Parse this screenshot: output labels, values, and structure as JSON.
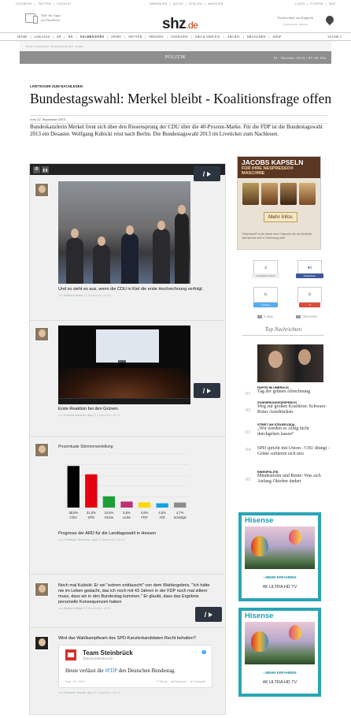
{
  "topbar": {
    "left": [
      "FACEBOOK",
      "TWITTER",
      "GOOGLE+"
    ],
    "mid": [
      "IMMOBILIEN",
      "AUTOS",
      "STELLEN",
      "ANZEIGEN"
    ],
    "right": [
      "LOGIN",
      "E-PAPER",
      "ABO"
    ]
  },
  "masthead": {
    "app_text_1": "Alle shz Apps",
    "app_text_2": "im Überblick",
    "logo_main": "shz",
    "logo_suffix": ".de",
    "region_text": "Nachrichten aus Kappeln",
    "region_sub": "(Schleiboten | ändern)"
  },
  "nav": {
    "items": [
      "HOME",
      "LOKALES",
      "SH",
      "HH",
      "NACHRICHTEN",
      "SPORT",
      "WETTER",
      "FREIZEIT",
      "ANZEIGEN",
      "ABO & SERVICE",
      "ARCHIV",
      "BRANCHEN",
      "SHOP"
    ],
    "search_label": "SUCHE"
  },
  "breadcrumb": "Home › Nachrichten › Deutschland & Welt › Politik",
  "section": {
    "title": "POLITIK",
    "date": "01. Oktober 2013 | 07:36 Uhr"
  },
  "article": {
    "kicker": "LIVETICKER ZUM NACHLESEN",
    "headline": "Bundestagswahl: Merkel bleibt - Koalitionsfrage offen",
    "byline": "vom 22. September 2013",
    "lead": "Bundeskanzlerin Merkel freut sich über den Riesensprung der CDU über die 40-Prozent-Marke. Für die FDP ist die Bundestagswahl 2013 ein Desaster. Wolfgang Kubicki reist nach Berlin. Die Bundestagswahl 2013 im Liveticker zum Nachlesen."
  },
  "ticker": {
    "gear_glyph": "⚙",
    "pause_glyph": "❚❚",
    "video_glyph": "/",
    "posts": [
      {
        "text": "Und so sieht es aus, wenn die CDU in Kiel die erste Hochrechnung verfolgt.",
        "meta_prefix": "von",
        "author": "Barbara Maas",
        "date": "22 September 18:08"
      },
      {
        "text": "Erste Reaktion bei den Grünen.",
        "meta_prefix": "von",
        "author": "Kristina Wiesner, dpa",
        "date": "22 September 18:09"
      },
      {
        "text": "Prognose der ARD für die Landtagswahl in Hessen",
        "meta_prefix": "von",
        "author": "Christoph Dietmann, dpa",
        "date": "22 September 18:18"
      },
      {
        "text": "Noch mal Kubicki: Er sei \"extrem enttäuscht\" von dem Wahlergebnis. \"Ich hätte nie im Leben gedacht, das ich noch mit 43 Jahren in der FDP noch mal zittern muss, dass wir in den Bundestag kommen.\" Er glaubt, dass das Ergebnis personelle Konsequenzen haben",
        "meta_prefix": "von",
        "author": "Barbara Maas",
        "date": "22 September 18:19"
      },
      {
        "text": "Wird das Wahlkampfteam des SPD-Kanzlerkandidaten Recht behalten?",
        "meta_prefix": "von",
        "author": "Henryser Schott, dpa",
        "date": "22 September 18:19"
      }
    ],
    "tweet": {
      "name": "Team Steinbrück",
      "handle": "@teamSteinbrueck",
      "text_before": "Heute verlässt die ",
      "hashtag": "#FDP",
      "text_after": " den Deutschen Bundestag.",
      "date": "Sep. 22, 2013",
      "reply": "Reply",
      "retweet": "Retweet",
      "favorite": "Favorite"
    }
  },
  "chart_data": {
    "type": "bar",
    "title": "Prozentuale Stimmenverteilung",
    "categories": [
      "CDU",
      "SPD",
      "Grüne",
      "Linke",
      "FDP",
      "AfD",
      "Sonstige"
    ],
    "value_labels": [
      "38,8%",
      "31,0%",
      "10,5%",
      "5,6%",
      "4,8%",
      "4,0%",
      "4,7%"
    ],
    "values": [
      38.8,
      31.0,
      10.5,
      5.6,
      4.8,
      4.0,
      4.7
    ],
    "colors": [
      "#000000",
      "#e3000f",
      "#1aa037",
      "#be3075",
      "#ffd600",
      "#13a3e0",
      "#8c8c8c"
    ],
    "ylim": [
      0,
      50
    ],
    "grid": true
  },
  "sidebar": {
    "ad_jacobs": {
      "title": "JACOBS KAPSELN",
      "subtitle": "FÜR IHRE NESPRESSO® MASCHINE",
      "cta": "Mehr Infos",
      "fine_print": "*Nespresso® ist die Marke einer Drittpartei, die mit Mondelēz International nicht in Verbindung steht."
    },
    "shares": {
      "comments_count": "4",
      "comments_label": "KOMMENTARE",
      "fb_count": "0",
      "fb_label": "Empfehlen",
      "tw_count": "0",
      "tw_label": "Twittern",
      "gp_count": "0",
      "gp_label": "+1",
      "email_label": "E-MAIL",
      "print_label": "DRUCKEN"
    },
    "top_news_heading": "Top Nachrichten",
    "top_news": [
      {
        "num": "01",
        "kicker": "PARTEI IM UMBRUCH",
        "title": "Tag der grünen Abrechnung"
      },
      {
        "num": "02",
        "kicker": "SONDIERUNGSGESPRÄCH",
        "title": "Weg zur großen Koalition: Schwarz-Rotes Armdrücken"
      },
      {
        "num": "03",
        "kicker": "STREIT UM STEUER-DEAL",
        "title": "„Wir werden es Albig nicht durchgehen lassen“"
      },
      {
        "num": "04",
        "kicker": "",
        "title": "SPD spricht mit Union - CSU drängt - Grüne sortieren sich neu"
      },
      {
        "num": "05",
        "kicker": "INNENPOLITIK",
        "title": "Mindestlohn und Rente: Was sich Anfang Oktober ändert"
      }
    ],
    "hisense": {
      "logo": "Hisense",
      "cta": "› MEHR ERFAHREN",
      "tag": "4K ULTRA HD TV"
    }
  }
}
